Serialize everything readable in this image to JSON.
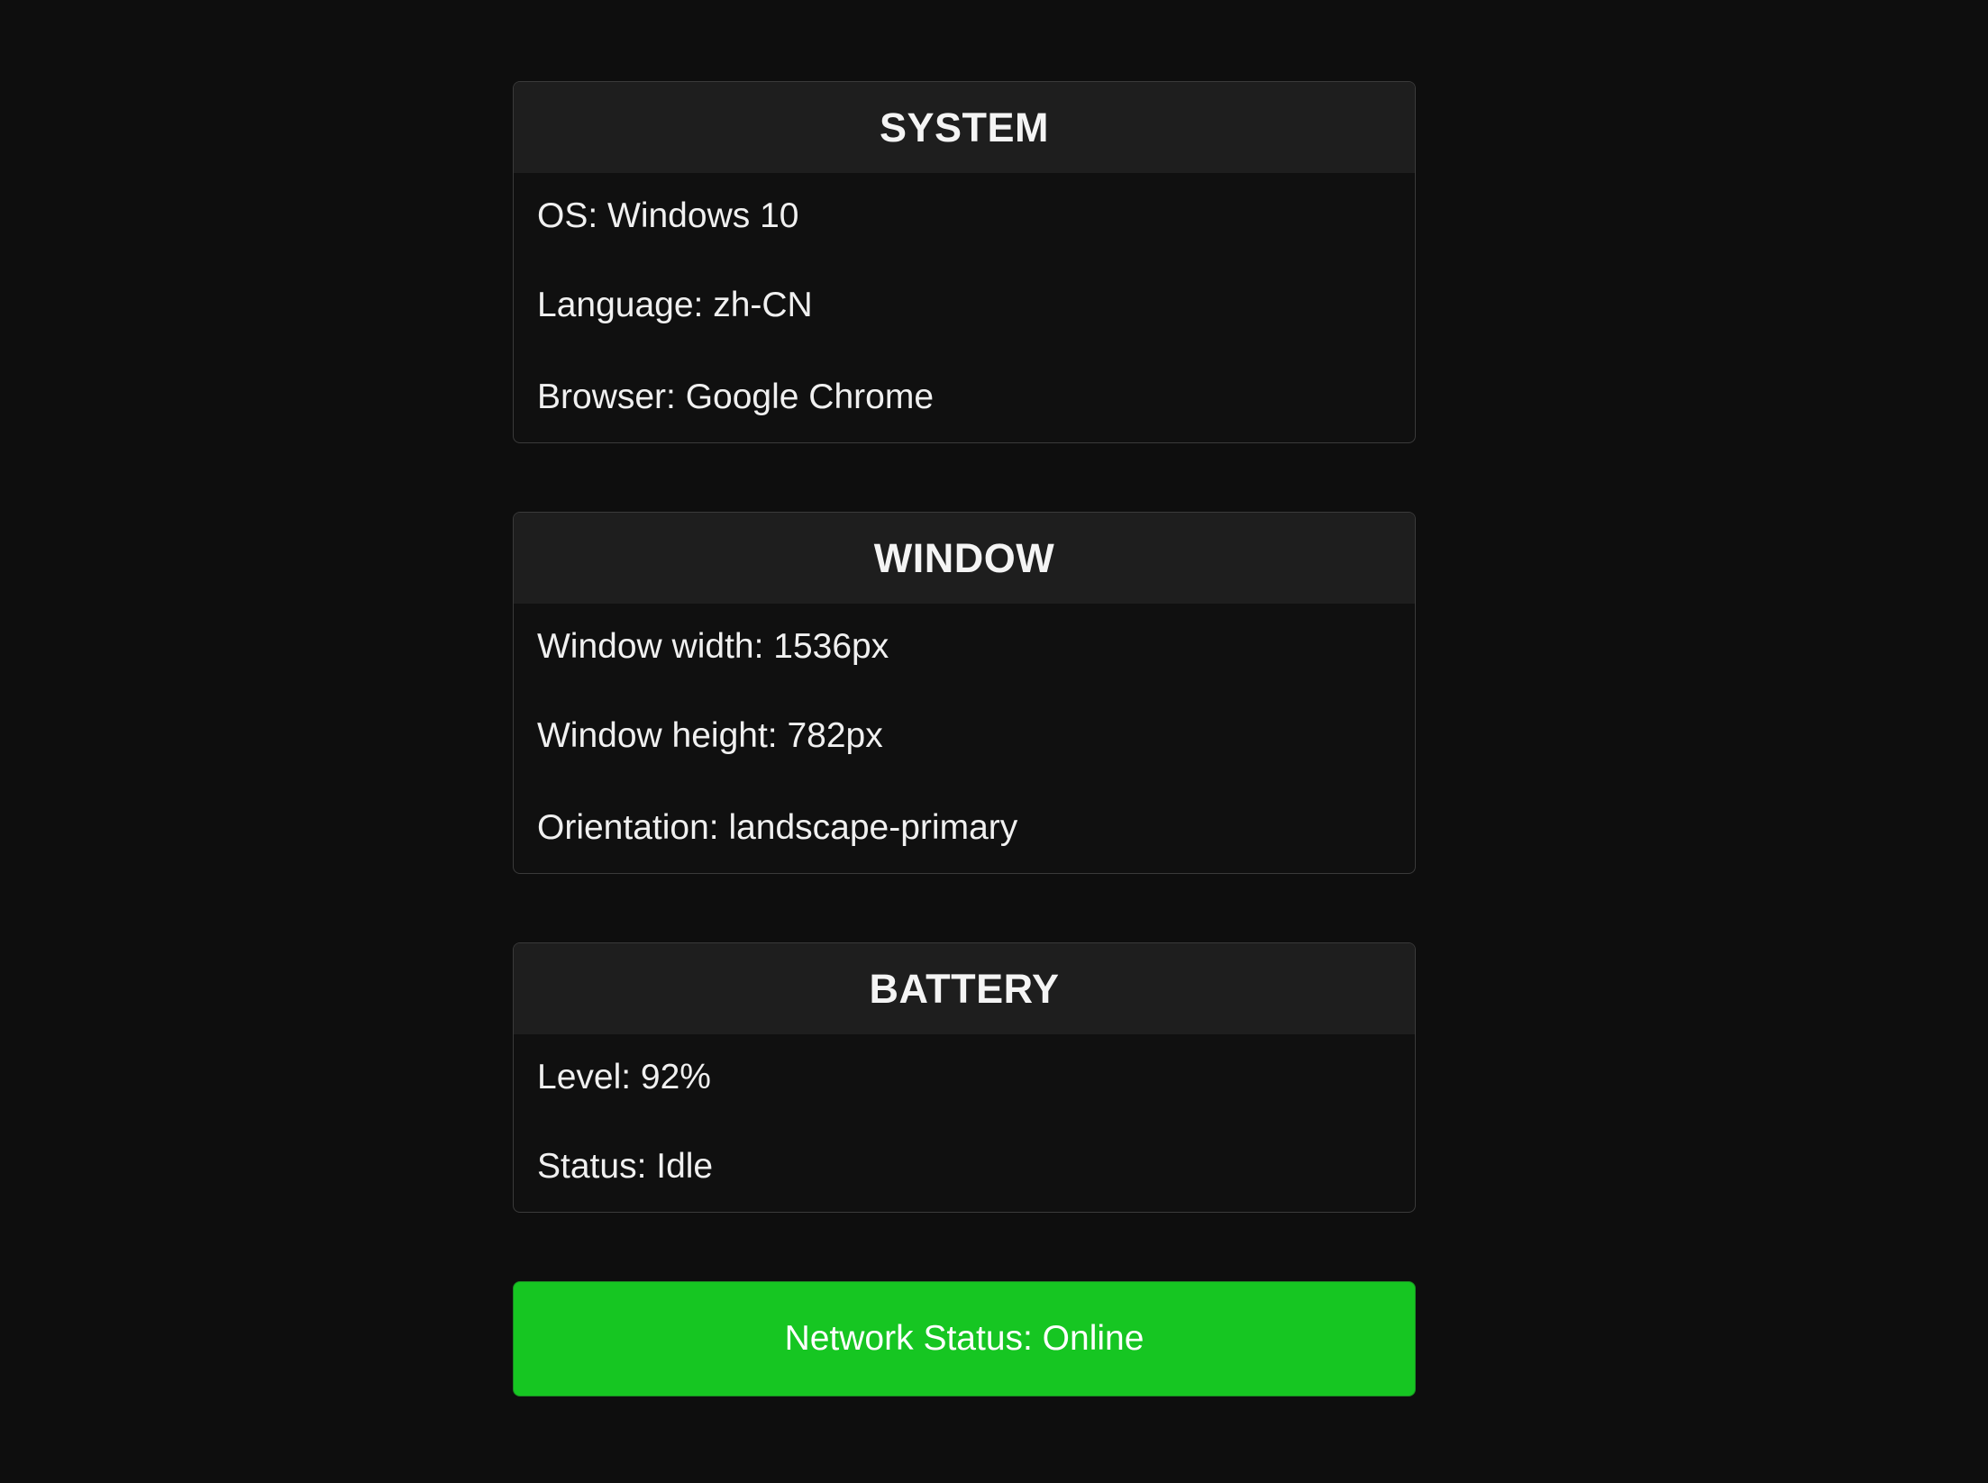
{
  "system": {
    "title": "SYSTEM",
    "rows": [
      "OS: Windows 10",
      "Language: zh-CN",
      "Browser: Google Chrome"
    ]
  },
  "window": {
    "title": "WINDOW",
    "rows": [
      "Window width: 1536px",
      "Window height: 782px",
      "Orientation: landscape-primary"
    ]
  },
  "battery": {
    "title": "BATTERY",
    "rows": [
      "Level: 92%",
      "Status: Idle"
    ]
  },
  "network": {
    "label": "Network Status: Online",
    "color": "#16c622"
  }
}
